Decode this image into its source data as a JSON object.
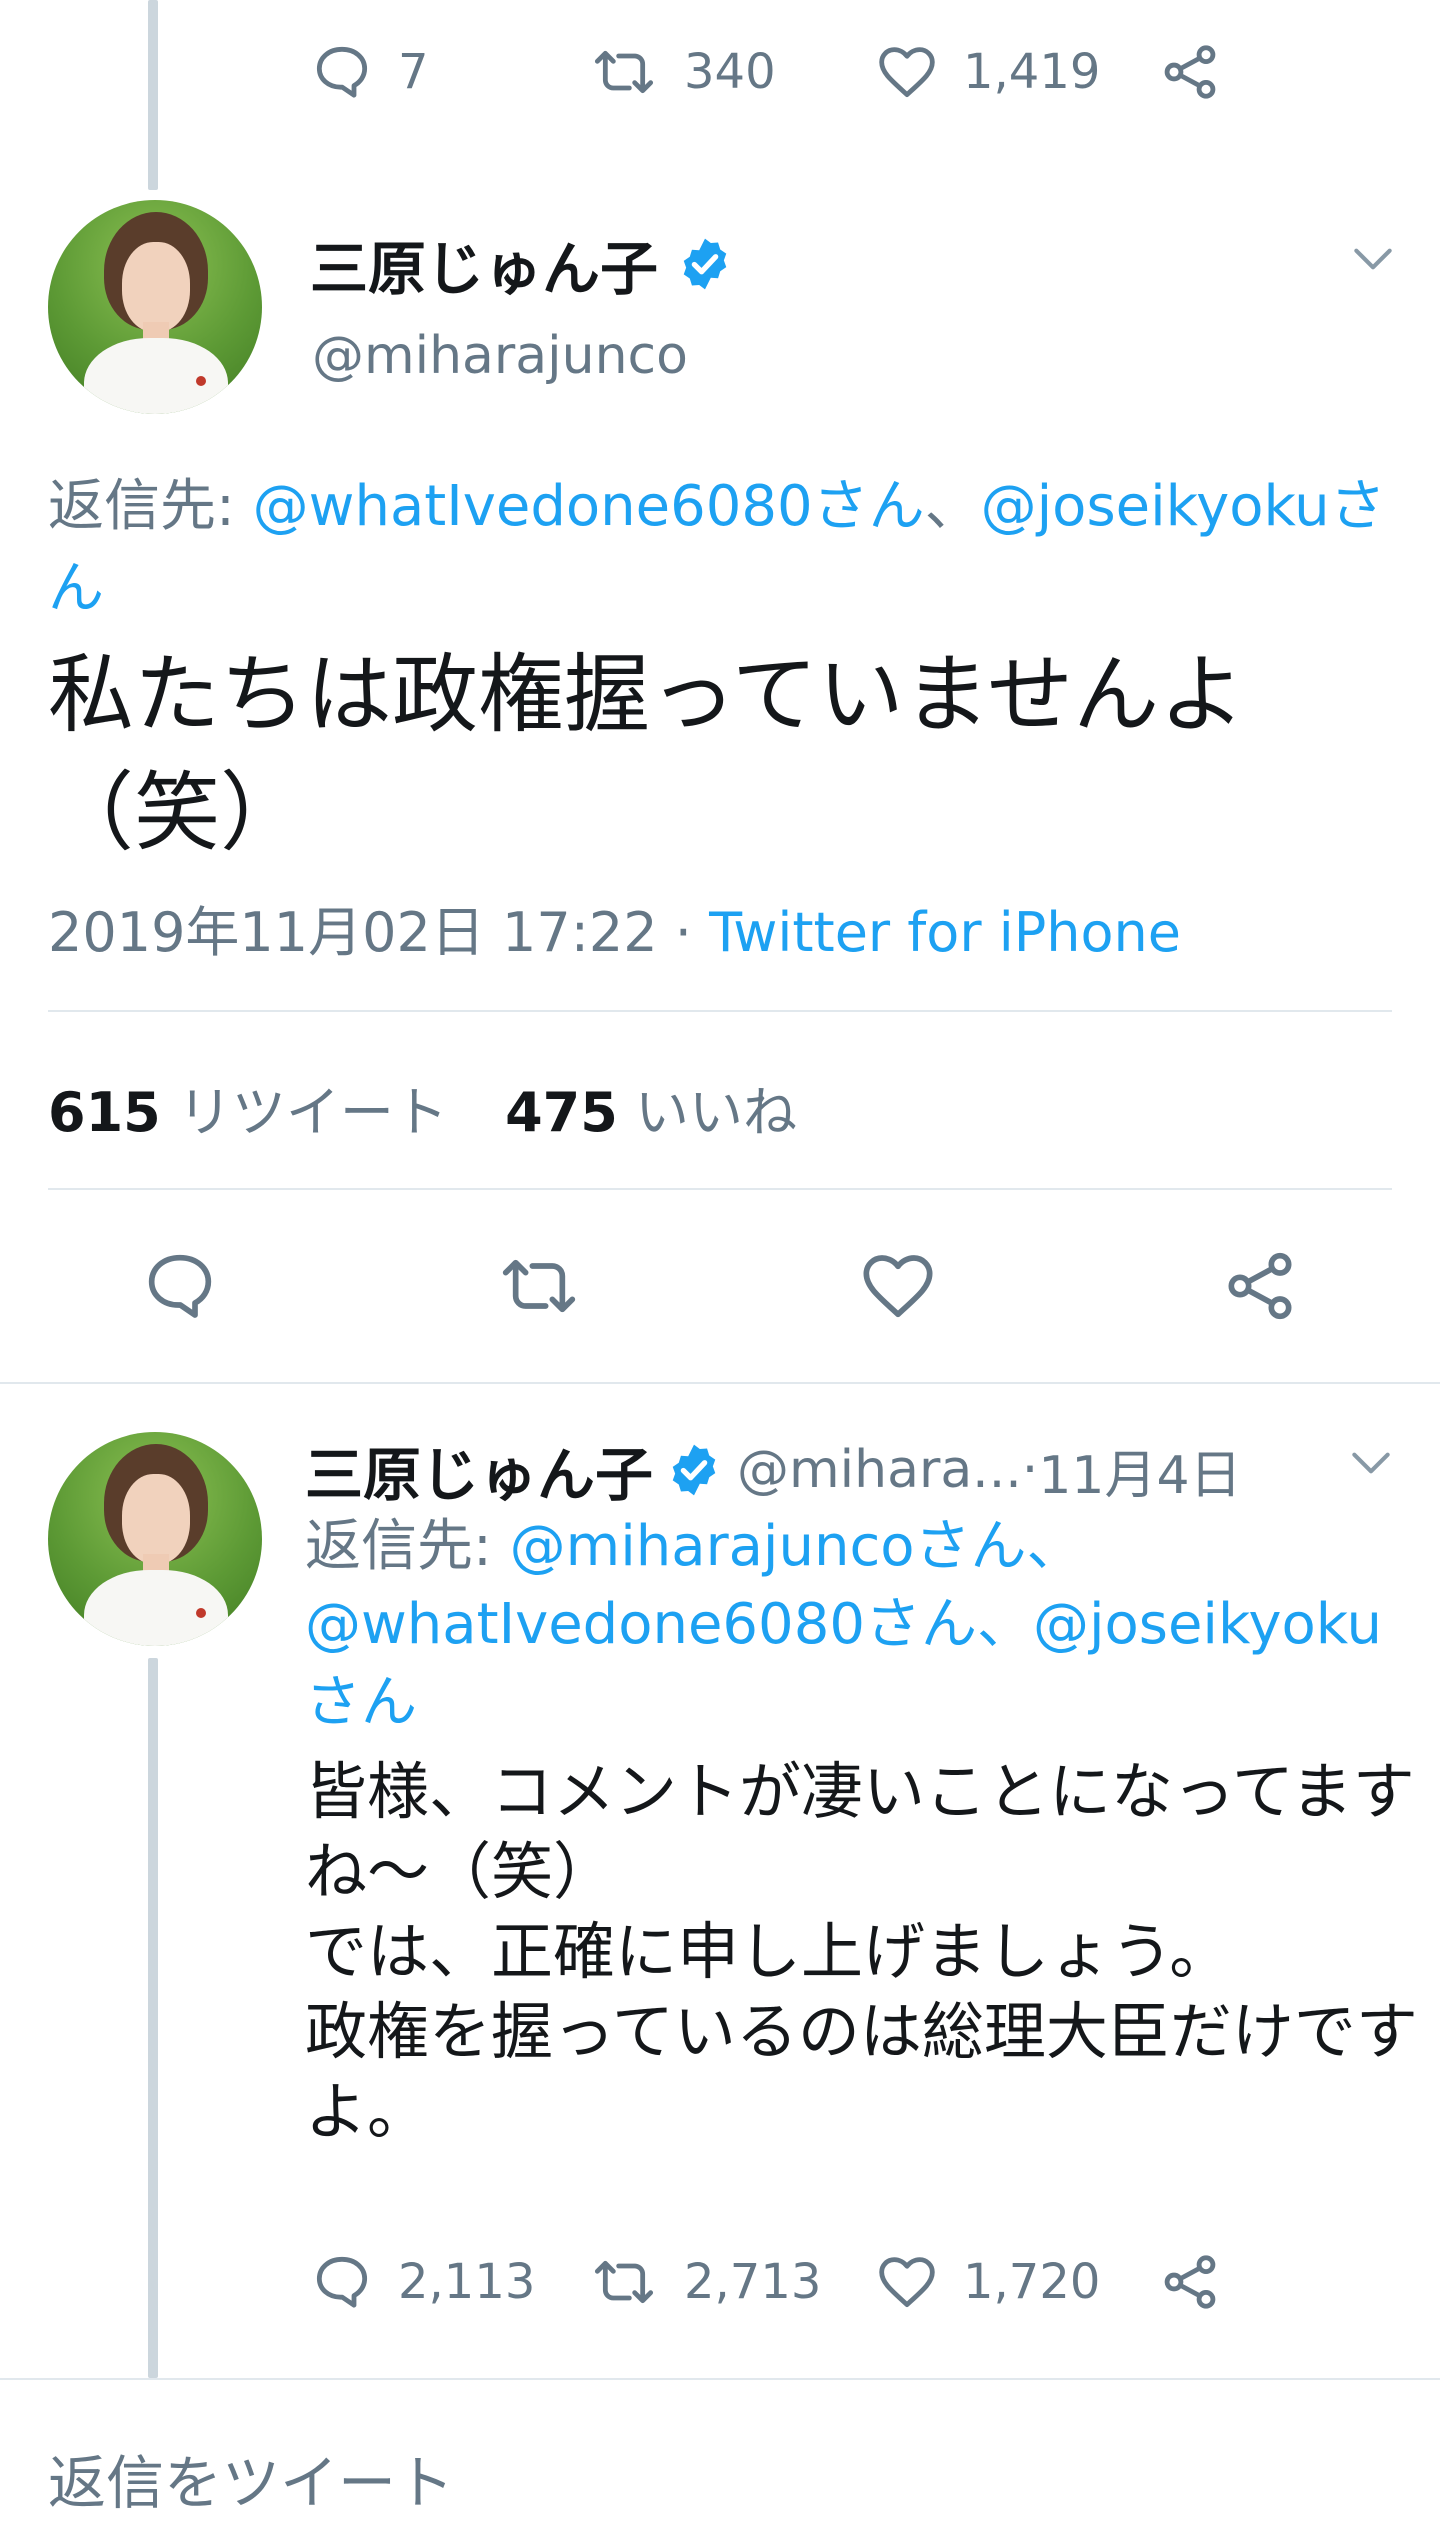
{
  "colors": {
    "accent": "#1da1f2",
    "text": "#14171a",
    "secondary": "#657786",
    "divider": "#e1e8ed",
    "thread_line": "#ccd6dd"
  },
  "prev_tweet_actions": {
    "reply_count": "7",
    "retweet_count": "340",
    "like_count": "1,419"
  },
  "main_tweet": {
    "author_name": "三原じゅん子",
    "author_handle": "@miharajunco",
    "reply_to_prefix": "返信先: ",
    "reply_to_link1": "@whatIvedone6080さん",
    "reply_to_sep": "、",
    "reply_to_link2_a": "@joseikyokuさ",
    "reply_to_link2_b": "ん",
    "text_line1": "私たちは政権握っていませんよ",
    "text_line2": "（笑）",
    "timestamp": "2019年11月02日 17:22",
    "meta_sep": " · ",
    "source": "Twitter for iPhone",
    "retweets_num": "615",
    "retweets_label": "リツイート",
    "likes_num": "475",
    "likes_label": "いいね",
    "icons": [
      "reply-icon",
      "retweet-icon",
      "like-icon",
      "share-icon",
      "chevron-down-icon",
      "verified-icon"
    ]
  },
  "reply_tweet": {
    "author_name": "三原じゅん子",
    "author_handle": "@mihara...",
    "meta_sep": " · ",
    "date": "11月4日",
    "reply_to_prefix": "返信先: ",
    "reply_to_link1": "@miharajuncoさん、",
    "reply_to_link2": "@whatIvedone6080さん、",
    "reply_to_link3": "@joseikyoku",
    "reply_to_link4": "さん",
    "text_line1": "皆様、コメントが凄いことになってます",
    "text_line2": "ね〜（笑）",
    "text_line3": "では、正確に申し上げましょう。",
    "text_line4": "政権を握っているのは総理大臣だけです",
    "text_line5": "よ。",
    "reply_count": "2,113",
    "retweet_count": "2,713",
    "like_count": "1,720"
  },
  "composer": {
    "placeholder": "返信をツイート"
  }
}
